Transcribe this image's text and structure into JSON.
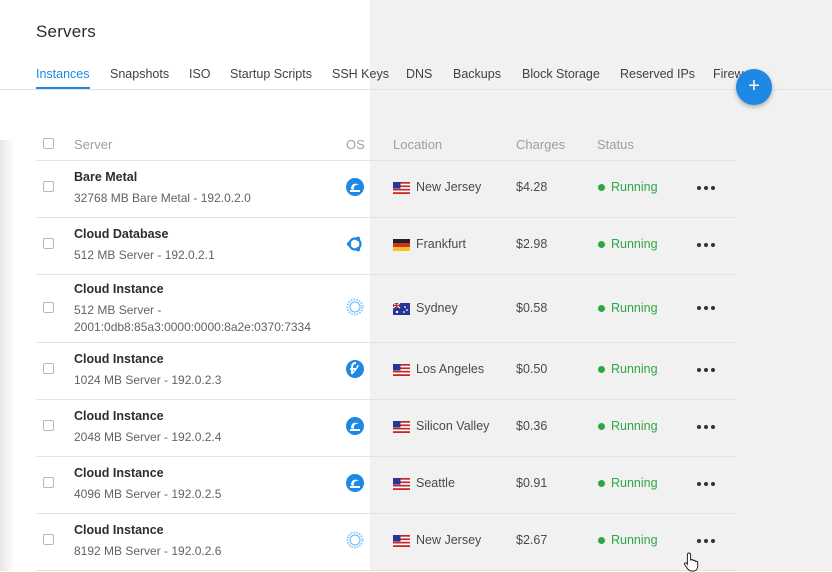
{
  "page": {
    "title": "Servers"
  },
  "tabs": [
    {
      "label": "Instances",
      "active": true
    },
    {
      "label": "Snapshots"
    },
    {
      "label": "ISO"
    },
    {
      "label": "Startup Scripts"
    },
    {
      "label": "SSH Keys"
    },
    {
      "label": "DNS"
    },
    {
      "label": "Backups"
    },
    {
      "label": "Block Storage"
    },
    {
      "label": "Reserved IPs"
    },
    {
      "label": "Firew"
    }
  ],
  "fab": {
    "label": "+",
    "icon": "plus-icon"
  },
  "table": {
    "headers": {
      "server": "Server",
      "os": "OS",
      "location": "Location",
      "charges": "Charges",
      "status": "Status"
    },
    "rows": [
      {
        "name": "Bare Metal",
        "desc": "32768 MB Bare Metal - 192.0.2.0",
        "os_icon": "debian-icon",
        "location": "New Jersey",
        "flag": "us-flag-icon",
        "charges": "$4.28",
        "status": "Running"
      },
      {
        "name": "Cloud Database",
        "desc": "512 MB Server - 192.0.2.1",
        "os_icon": "ubuntu-icon",
        "location": "Frankfurt",
        "flag": "de-flag-icon",
        "charges": "$2.98",
        "status": "Running"
      },
      {
        "name": "Cloud Instance",
        "desc": "512 MB Server - 2001:0db8:85a3:0000:0000:8a2e:0370:7334",
        "os_icon": "gear-os-icon",
        "location": "Sydney",
        "flag": "au-flag-icon",
        "charges": "$0.58",
        "status": "Running"
      },
      {
        "name": "Cloud Instance",
        "desc": "1024 MB Server - 192.0.2.3",
        "os_icon": "fedora-icon",
        "location": "Los Angeles",
        "flag": "us-flag-icon",
        "charges": "$0.50",
        "status": "Running"
      },
      {
        "name": "Cloud Instance",
        "desc": "2048 MB Server - 192.0.2.4",
        "os_icon": "debian-icon",
        "location": "Silicon Valley",
        "flag": "us-flag-icon",
        "charges": "$0.36",
        "status": "Running"
      },
      {
        "name": "Cloud Instance",
        "desc": "4096 MB Server - 192.0.2.5",
        "os_icon": "debian-icon",
        "location": "Seattle",
        "flag": "us-flag-icon",
        "charges": "$0.91",
        "status": "Running"
      },
      {
        "name": "Cloud Instance",
        "desc": "8192 MB Server - 192.0.2.6",
        "os_icon": "gear-os-icon",
        "location": "New Jersey",
        "flag": "us-flag-icon",
        "charges": "$2.67",
        "status": "Running"
      }
    ]
  },
  "colors": {
    "accent": "#1e88e5",
    "running": "#2fa742"
  }
}
